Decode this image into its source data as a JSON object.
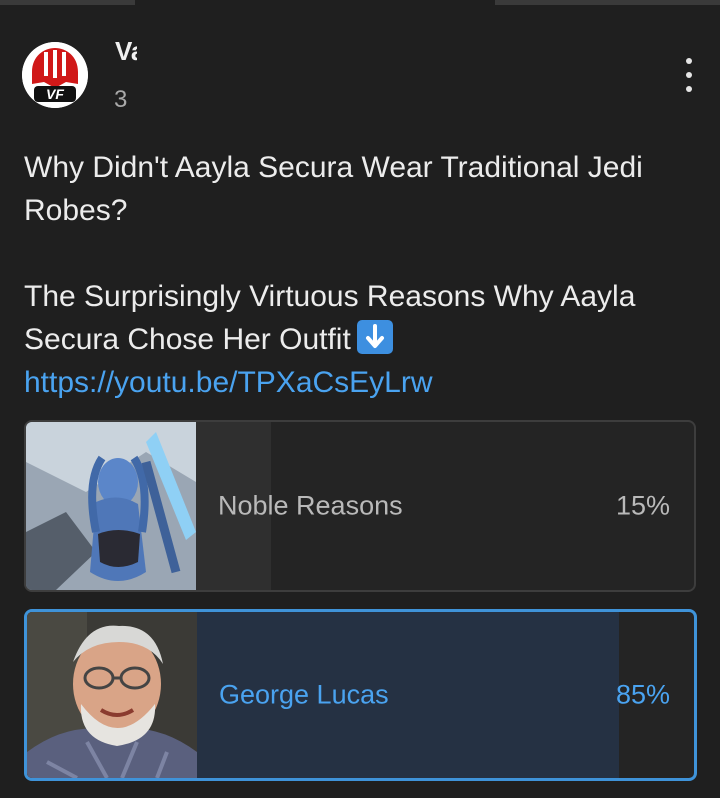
{
  "post": {
    "author_name": "Va",
    "time": "3",
    "title_line": "Why Didn't Aayla Secura Wear Traditional Jedi Robes?",
    "body_line": "The Surprisingly Virtuous Reasons Why Aayla Secura Chose Her Outfit",
    "emoji": "down-arrow-emoji",
    "link": "https://youtu.be/TPXaCsEyLrw",
    "avatar_text": "VF"
  },
  "poll": {
    "options": [
      {
        "label": "Noble Reasons",
        "percent_text": "15%",
        "percent": 15,
        "selected": false
      },
      {
        "label": "George Lucas",
        "percent_text": "85%",
        "percent": 85,
        "selected": true
      }
    ]
  },
  "colors": {
    "background": "#1f1f1f",
    "link": "#4aa3f0",
    "selected_border": "#3f93d9",
    "selected_fill": "#253143",
    "logo_red": "#d01818"
  },
  "icons": {
    "menu": "more-vertical-icon"
  }
}
